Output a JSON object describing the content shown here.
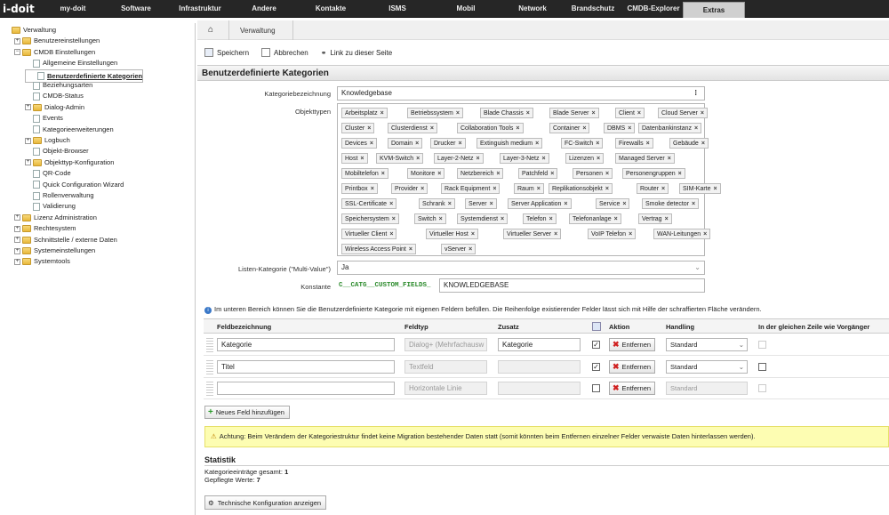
{
  "app": {
    "logo_text": "i-doit"
  },
  "topnav": [
    {
      "label": "my-doit",
      "width": 72
    },
    {
      "label": "Software",
      "width": 70
    },
    {
      "label": "Infrastruktur",
      "width": 74
    },
    {
      "label": "Andere",
      "width": 70
    },
    {
      "label": "Kontakte",
      "width": 80
    },
    {
      "label": "ISMS",
      "width": 70
    },
    {
      "label": "Mobil",
      "width": 84
    },
    {
      "label": "Network",
      "width": 66
    },
    {
      "label": "Brandschutz",
      "width": 70
    },
    {
      "label": "CMDB-Explorer",
      "width": 66
    },
    {
      "label": "Extras",
      "width": 70,
      "active": true
    }
  ],
  "sidebar": {
    "items": [
      {
        "label": "Verwaltung",
        "pm": "",
        "icon": "folder",
        "level": 0
      },
      {
        "label": "Benutzereinstellungen",
        "pm": "+",
        "icon": "folder",
        "level": 1
      },
      {
        "label": "CMDB Einstellungen",
        "pm": "−",
        "icon": "folder",
        "level": 1
      },
      {
        "label": "Allgemeine Einstellungen",
        "pm": "",
        "icon": "page",
        "level": 2
      },
      {
        "label": "Benutzerdefinierte Kategorien",
        "pm": "",
        "icon": "page",
        "level": 2,
        "selected": true
      },
      {
        "label": "Beziehungsarten",
        "pm": "",
        "icon": "page",
        "level": 2
      },
      {
        "label": "CMDB-Status",
        "pm": "",
        "icon": "page",
        "level": 2
      },
      {
        "label": "Dialog-Admin",
        "pm": "+",
        "icon": "folder",
        "level": 2
      },
      {
        "label": "Events",
        "pm": "",
        "icon": "page",
        "level": 2
      },
      {
        "label": "Kategorieerweiterungen",
        "pm": "",
        "icon": "page",
        "level": 2
      },
      {
        "label": "Logbuch",
        "pm": "+",
        "icon": "folder",
        "level": 2
      },
      {
        "label": "Objekt-Browser",
        "pm": "",
        "icon": "page",
        "level": 2
      },
      {
        "label": "Objekttyp-Konfiguration",
        "pm": "+",
        "icon": "folder",
        "level": 2
      },
      {
        "label": "QR-Code",
        "pm": "",
        "icon": "page",
        "level": 2
      },
      {
        "label": "Quick Configuration Wizard",
        "pm": "",
        "icon": "page",
        "level": 2
      },
      {
        "label": "Rollenverwaltung",
        "pm": "",
        "icon": "page",
        "level": 2
      },
      {
        "label": "Validierung",
        "pm": "",
        "icon": "page",
        "level": 2
      },
      {
        "label": "Lizenz Administration",
        "pm": "+",
        "icon": "folder",
        "level": 1
      },
      {
        "label": "Rechtesystem",
        "pm": "+",
        "icon": "folder",
        "level": 1
      },
      {
        "label": "Schnittstelle / externe Daten",
        "pm": "+",
        "icon": "folder",
        "level": 1
      },
      {
        "label": "Systemeinstellungen",
        "pm": "+",
        "icon": "folder",
        "level": 1
      },
      {
        "label": "Systemtools",
        "pm": "+",
        "icon": "folder",
        "level": 1
      }
    ]
  },
  "breadcrumb": {
    "label": "Verwaltung"
  },
  "toolbar": {
    "save": "Speichern",
    "cancel": "Abbrechen",
    "link": "Link zu dieser Seite"
  },
  "page_title": "Benutzerdefinierte Kategorien",
  "form": {
    "category_label": "Kategoriebezeichnung",
    "category_value": "Knowledgebase",
    "objecttypes_label": "Objekttypen",
    "multivalue_label": "Listen-Kategorie (\"Multi-Value\")",
    "multivalue_value": "Ja",
    "constant_label": "Konstante",
    "constant_prefix": "C__CATG__CUSTOM_FIELDS_",
    "constant_value": "KNOWLEDGEBASE"
  },
  "tags": [
    [
      "Arbeitsplatz",
      "Betriebssystem",
      "Blade Chassis",
      "Blade Server",
      "Client",
      "Cloud Server"
    ],
    [
      "Cluster",
      "Clusterdienst",
      "Collaboration Tools",
      "Container",
      "DBMS",
      "Datenbankinstanz"
    ],
    [
      "Devices",
      "Domain",
      "Drucker",
      "Extinguish medium",
      "FC-Switch",
      "Firewalls",
      "Gebäude"
    ],
    [
      "Host",
      "KVM-Switch",
      "Layer-2-Netz",
      "Layer-3-Netz",
      "Lizenzen",
      "Managed Server"
    ],
    [
      "Mobiltelefon",
      "Monitore",
      "Netzbereich",
      "Patchfeld",
      "Personen",
      "Personengruppen"
    ],
    [
      "Printbox",
      "Provider",
      "Rack Equipment",
      "Raum",
      "Replikationsobjekt",
      "Router",
      "SIM-Karte"
    ],
    [
      "SSL-Certificate",
      "Schrank",
      "Server",
      "Server Application",
      "Service",
      "Smoke detector"
    ],
    [
      "Speichersystem",
      "Switch",
      "Systemdienst",
      "Telefon",
      "Telefonanlage",
      "Vertrag"
    ],
    [
      "Virtueller Client",
      "Virtueller Host",
      "Virtueller Server",
      "VoIP Telefon",
      "WAN-Leitungen"
    ],
    [
      "Wireless Access Point",
      "vServer"
    ]
  ],
  "info_text": "Im unteren Bereich können Sie die Benutzerdefinierte Kategorie mit eigenen Feldern befüllen. Die Reihenfolge existierender Felder lässt sich mit Hilfe der schraffierten Fläche verändern.",
  "table": {
    "headers": {
      "field": "Feldbezeichnung",
      "type": "Feldtyp",
      "extra": "Zusatz",
      "action": "Aktion",
      "handling": "Handling",
      "same_row": "In der gleichen Zeile wie Vorgänger"
    },
    "rows": [
      {
        "field": "Kategorie",
        "type": "Dialog+ (Mehrfachausw",
        "extra": "Kategorie",
        "checked": true,
        "delete": "Entfernen",
        "handling": "Standard",
        "type_disabled": true,
        "handling_disabled": false,
        "same_disabled": true
      },
      {
        "field": "Titel",
        "type": "Textfeld",
        "extra": "",
        "checked": true,
        "delete": "Entfernen",
        "handling": "Standard",
        "type_disabled": true,
        "handling_disabled": false,
        "same_disabled": false
      },
      {
        "field": "",
        "type": "Horizontale Linie",
        "extra": "",
        "checked": false,
        "delete": "Entfernen",
        "handling": "Standard",
        "type_disabled": true,
        "handling_disabled": true,
        "same_disabled": true
      }
    ],
    "add_button": "Neues Feld hinzufügen"
  },
  "warning": "Achtung: Beim Verändern der Kategoriestruktur findet keine Migration bestehender Daten statt (somit könnten beim Entfernen einzelner Felder verwaiste Daten hinterlassen werden).",
  "statistics": {
    "title": "Statistik",
    "entries_label": "Kategorieeinträge gesamt:",
    "entries_value": "1",
    "values_label": "Gepflegte Werte:",
    "values_value": "7"
  },
  "tech_button": "Technische Konfiguration anzeigen"
}
